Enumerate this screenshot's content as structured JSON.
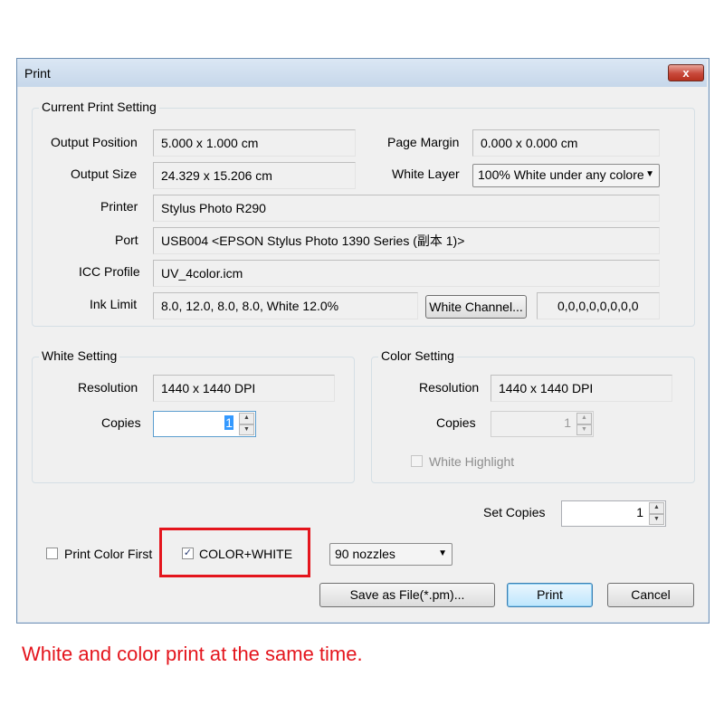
{
  "window": {
    "title": "Print",
    "close_label": "x"
  },
  "current_print_setting": {
    "title": "Current Print Setting",
    "output_position": {
      "label": "Output Position",
      "value": "5.000 x 1.000 cm"
    },
    "page_margin": {
      "label": "Page Margin",
      "value": "0.000 x 0.000 cm"
    },
    "output_size": {
      "label": "Output Size",
      "value": "24.329 x 15.206 cm"
    },
    "white_layer": {
      "label": "White Layer",
      "value": "100% White under any colore"
    },
    "printer": {
      "label": "Printer",
      "value": "Stylus Photo R290"
    },
    "port": {
      "label": "Port",
      "value": "USB004  <EPSON Stylus Photo 1390 Series (副本 1)>"
    },
    "icc_profile": {
      "label": "ICC Profile",
      "value": "UV_4color.icm"
    },
    "ink_limit": {
      "label": "Ink Limit",
      "value": "8.0, 12.0, 8.0, 8.0, White 12.0%"
    },
    "white_channel_button": "White Channel...",
    "white_channel_value": "0,0,0,0,0,0,0,0"
  },
  "white_setting": {
    "title": "White Setting",
    "resolution": {
      "label": "Resolution",
      "value": "1440 x 1440 DPI"
    },
    "copies": {
      "label": "Copies",
      "value": "1"
    }
  },
  "color_setting": {
    "title": "Color Setting",
    "resolution": {
      "label": "Resolution",
      "value": "1440 x 1440 DPI"
    },
    "copies": {
      "label": "Copies",
      "value": "1"
    },
    "white_highlight": {
      "label": "White Highlight",
      "checked": false
    }
  },
  "set_copies": {
    "label": "Set Copies",
    "value": "1"
  },
  "print_color_first": {
    "label": "Print Color First",
    "checked": false
  },
  "color_white": {
    "label": "COLOR+WHITE",
    "checked": true,
    "check_glyph": "✓"
  },
  "nozzles": {
    "value": "90 nozzles"
  },
  "buttons": {
    "save": "Save as File(*.pm)...",
    "print": "Print",
    "cancel": "Cancel"
  },
  "combo_arrow": "▼",
  "spin_up": "▲",
  "spin_down": "▼",
  "caption": "White and color print at the same time.",
  "colors": {
    "annotation_red": "#e4151d",
    "title_bar": "#c6d7ea"
  }
}
